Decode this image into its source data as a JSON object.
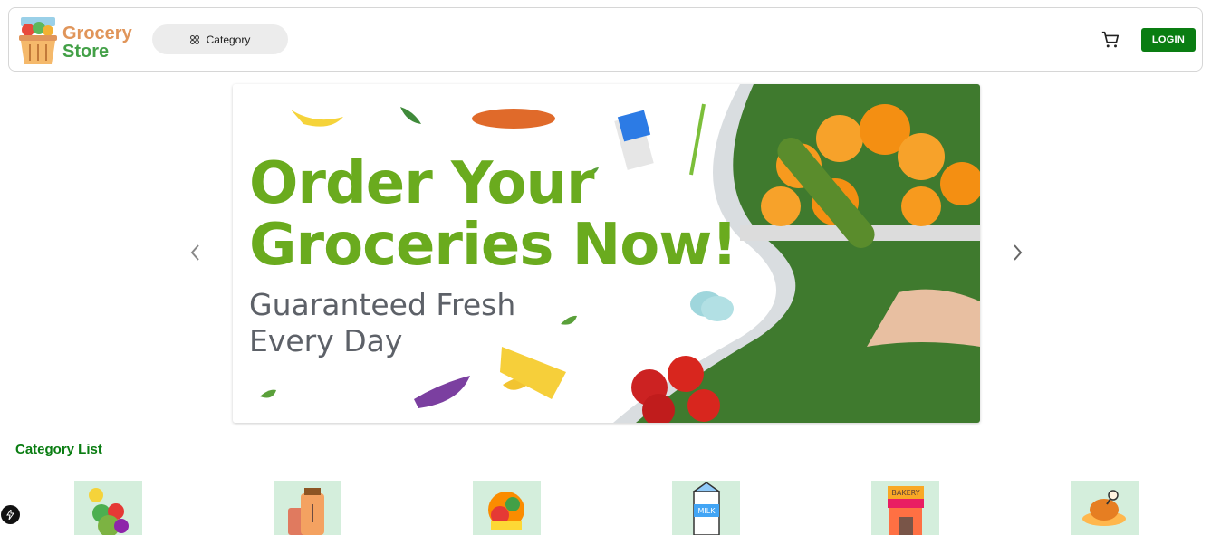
{
  "header": {
    "logo_line1": "Grocery",
    "logo_line2": "Store",
    "category_button": "Category",
    "login_label": "LOGIN",
    "icons": [
      "basket-logo",
      "grid-icon",
      "cart-icon"
    ]
  },
  "carousel": {
    "headline_line1": "Order Your",
    "headline_line2": "Groceries Now!",
    "sub_line1": "Guaranteed Fresh",
    "sub_line2": "Every Day",
    "icons": [
      "chevron-left-icon",
      "chevron-right-icon"
    ],
    "colors": {
      "headline": "#6aab1e",
      "sub": "#5d6168"
    }
  },
  "categories": {
    "title": "Category List",
    "item_icons": [
      "veggies-icon",
      "grains-icon",
      "fruits-icon",
      "milk-icon",
      "bakery-icon",
      "meat-icon"
    ]
  },
  "colors": {
    "brand_green": "#0a7d12",
    "logo_orange": "#e0955a",
    "logo_green": "#43a047",
    "tile_bg": "#d4eedc"
  }
}
